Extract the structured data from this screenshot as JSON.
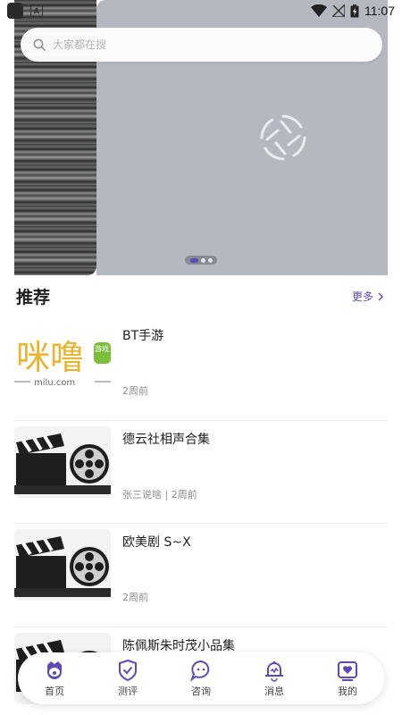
{
  "status_bar": {
    "time": "11:07"
  },
  "search": {
    "placeholder": "大家都在搜"
  },
  "banner": {
    "slide_count": 3,
    "active_slide": 1
  },
  "section": {
    "title": "推荐",
    "more_label": "更多"
  },
  "items": [
    {
      "title": "BT手游",
      "meta": "2周前",
      "thumb": "milu-logo",
      "logo_text": "咪噜",
      "logo_badge": "游戏",
      "logo_url": "milu.com"
    },
    {
      "title": "德云社相声合集",
      "meta": "张三说啥 | 2周前",
      "thumb": "film-clapper-icon"
    },
    {
      "title": "欧美剧 S~X",
      "meta": "2周前",
      "thumb": "film-clapper-icon"
    },
    {
      "title": "陈佩斯朱时茂小品集",
      "meta": "",
      "thumb": "film-clapper-icon"
    }
  ],
  "nav": [
    {
      "label": "首页",
      "icon": "home-face-icon",
      "active": true
    },
    {
      "label": "测评",
      "icon": "shield-check-icon",
      "active": false
    },
    {
      "label": "咨询",
      "icon": "chat-bubble-icon",
      "active": false
    },
    {
      "label": "消息",
      "icon": "bell-icon",
      "active": false
    },
    {
      "label": "我的",
      "icon": "heart-profile-icon",
      "active": false
    }
  ],
  "colors": {
    "accent": "#5b4bb4",
    "banner_bg": "#b4b8c1"
  }
}
